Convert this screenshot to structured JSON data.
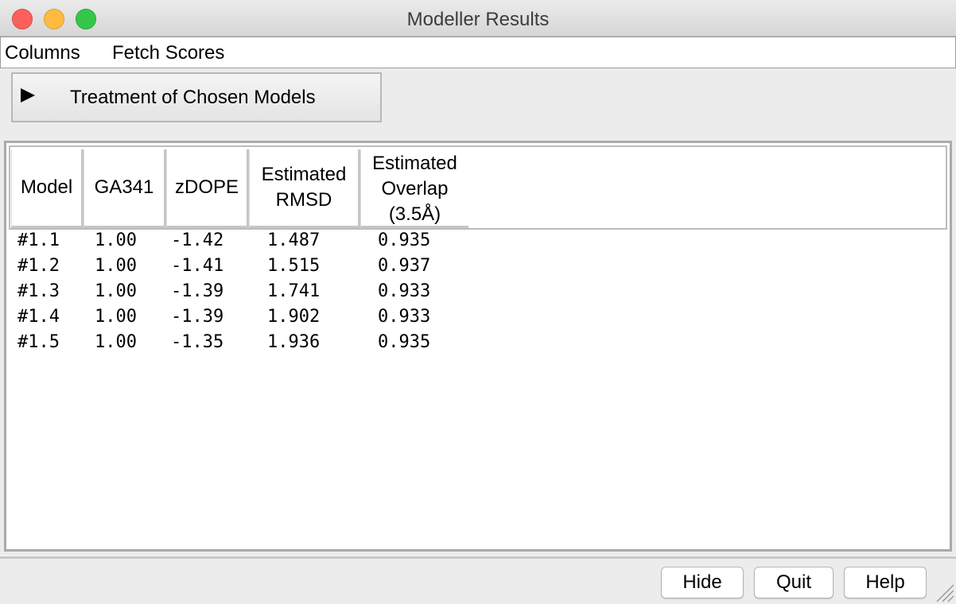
{
  "window": {
    "title": "Modeller Results"
  },
  "menubar": {
    "items": [
      "Columns",
      "Fetch Scores"
    ]
  },
  "disclosure": {
    "label": "Treatment of Chosen Models",
    "expanded": false
  },
  "table": {
    "columns": [
      "Model",
      "GA341",
      "zDOPE",
      "Estimated\nRMSD",
      "Estimated\nOverlap\n(3.5Å)"
    ],
    "rows": [
      [
        "#1.1",
        "1.00",
        "-1.42",
        "1.487",
        "0.935"
      ],
      [
        "#1.2",
        "1.00",
        "-1.41",
        "1.515",
        "0.937"
      ],
      [
        "#1.3",
        "1.00",
        "-1.39",
        "1.741",
        "0.933"
      ],
      [
        "#1.4",
        "1.00",
        "-1.39",
        "1.902",
        "0.933"
      ],
      [
        "#1.5",
        "1.00",
        "-1.35",
        "1.936",
        "0.935"
      ]
    ]
  },
  "buttons": {
    "hide": "Hide",
    "quit": "Quit",
    "help": "Help"
  }
}
